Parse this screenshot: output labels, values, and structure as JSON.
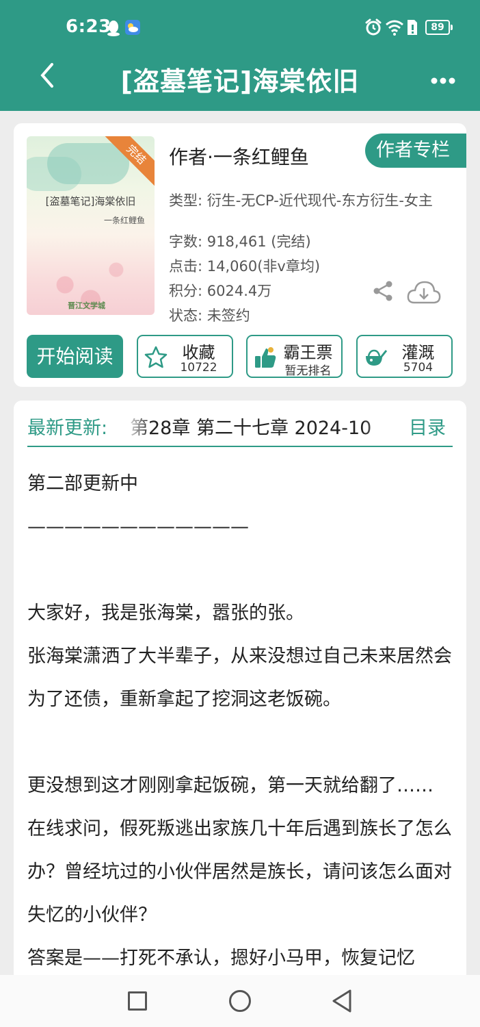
{
  "status_bar": {
    "time": "6:23",
    "battery": "89"
  },
  "header": {
    "title": "[盗墓笔记]海棠依旧"
  },
  "book": {
    "cover": {
      "badge": "完结",
      "title": "[盗墓笔记]海棠依旧",
      "author": "一条红鲤鱼",
      "logo": "晋江文学城"
    },
    "author": "作者·一条红鲤鱼",
    "author_column_label": "作者专栏",
    "type_line": "类型: 衍生-无CP-近代现代-东方衍生-女主",
    "words": "字数: 918,461 (完结)",
    "clicks": "点击: 14,060(非v章均)",
    "score": "积分: 6024.4万",
    "state": "状态: 未签约"
  },
  "actions": {
    "read": "开始阅读",
    "favorite": {
      "label": "收藏",
      "count": "10722"
    },
    "ticket": {
      "label": "霸王票",
      "count": "暂无排名"
    },
    "water": {
      "label": "灌溉",
      "count": "5704"
    }
  },
  "latest": {
    "label": "最新更新:",
    "value": "第28章  第二十七章  2024-10",
    "menu": "目录"
  },
  "description": [
    "第二部更新中",
    "————————————",
    "",
    "大家好，我是张海棠，嚣张的张。",
    "张海棠潇洒了大半辈子，从来没想过自己未来居然会为了还债，重新拿起了挖洞这老饭碗。",
    "",
    "更没想到这才刚刚拿起饭碗，第一天就给翻了……",
    "在线求问，假死叛逃出家族几十年后遇到族长了怎么办？曾经坑过的小伙伴居然是族长，请问该怎么面对失忆的小伙伴？",
    "答案是——打死不承认，摁好小马甲，恢复记忆"
  ],
  "colors": {
    "brand": "#2e9a86",
    "ribbon": "#e8843a"
  },
  "icons": [
    "qq-icon",
    "weather-icon",
    "alarm-icon",
    "wifi-icon",
    "sim-icon",
    "back-icon",
    "more-icon",
    "share-icon",
    "download-icon",
    "star-icon",
    "thumbs-up-icon",
    "watering-can-icon"
  ]
}
